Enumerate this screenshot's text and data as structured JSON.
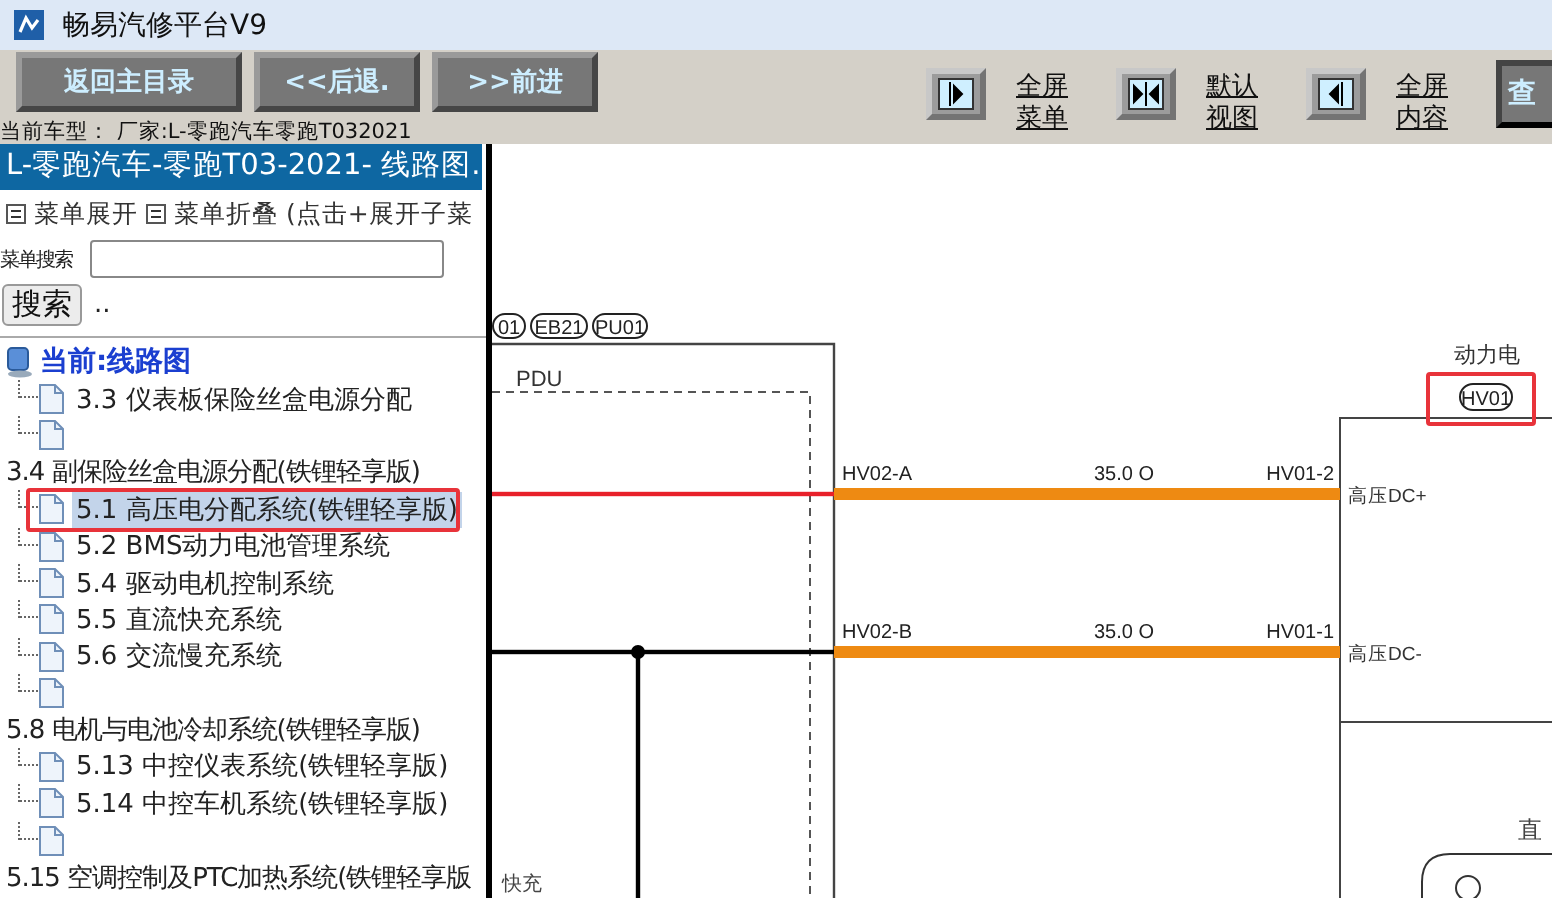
{
  "window": {
    "title": "畅易汽修平台V9"
  },
  "toolbar": {
    "nav_buttons": [
      "返回主目录",
      "<<后退.",
      ">>前进"
    ],
    "view_buttons": [
      {
        "kind": "right",
        "label": [
          "全屏",
          "菜单"
        ]
      },
      {
        "kind": "both",
        "label": [
          "默认",
          "视图"
        ]
      },
      {
        "kind": "left",
        "label": [
          "全屏",
          "内容"
        ]
      }
    ],
    "search_button": "查",
    "vehicle_info": "当前车型： 厂家:L-零跑汽车零跑T032021"
  },
  "sidebar": {
    "header": "L-零跑汽车-零跑T03-2021- 线路图.",
    "expand": "菜单展开",
    "collapse": "菜单折叠 (点击+展开子菜",
    "search_label": "菜单搜索",
    "search_button": "搜索",
    "more": "..",
    "tree": {
      "label": "当前:线路图",
      "children": [
        {
          "kind": "page",
          "label": "3.3 仪表板保险丝盒电源分配",
          "selected": false
        },
        {
          "kind": "page",
          "selected": false
        },
        {
          "kind": "group",
          "label": "3.4 副保险丝盒电源分配(铁锂轻享版)",
          "children": [
            {
              "kind": "page",
              "label": "5.1 高压电分配系统(铁锂轻享版)",
              "selected": true
            },
            {
              "kind": "page",
              "label": "5.2 BMS动力电池管理系统",
              "selected": false
            },
            {
              "kind": "page",
              "label": "5.4 驱动电机控制系统",
              "selected": false
            },
            {
              "kind": "page",
              "label": "5.5 直流快充系统",
              "selected": false
            },
            {
              "kind": "page",
              "label": "5.6 交流慢充系统",
              "selected": false
            },
            {
              "kind": "page",
              "selected": false
            }
          ]
        },
        {
          "kind": "group",
          "label": "5.8 电机与电池冷却系统(铁锂轻享版)",
          "children": [
            {
              "kind": "page",
              "label": "5.13 中控仪表系统(铁锂轻享版)",
              "selected": false
            },
            {
              "kind": "page",
              "label": "5.14 中控车机系统(铁锂轻享版)",
              "selected": false
            },
            {
              "kind": "page",
              "selected": false
            }
          ]
        },
        {
          "kind": "group",
          "label": "5.15 空调控制及PTC加热系统(铁锂轻享版"
        }
      ]
    }
  },
  "diagram": {
    "connector_tags": [
      "01",
      "EB21",
      "PU01"
    ],
    "module_label": "PDU",
    "battery_label": "动力电",
    "battery_tag": "HV01",
    "wires": [
      {
        "from": "HV02-A",
        "gauge": "35.0 O",
        "to": "HV01-2",
        "pin": "高压DC+",
        "color": "#e8202a"
      },
      {
        "from": "HV02-B",
        "gauge": "35.0 O",
        "to": "HV01-1",
        "pin": "高压DC-",
        "color": "#000000"
      }
    ],
    "left_label": "快充",
    "right_label": "直"
  }
}
